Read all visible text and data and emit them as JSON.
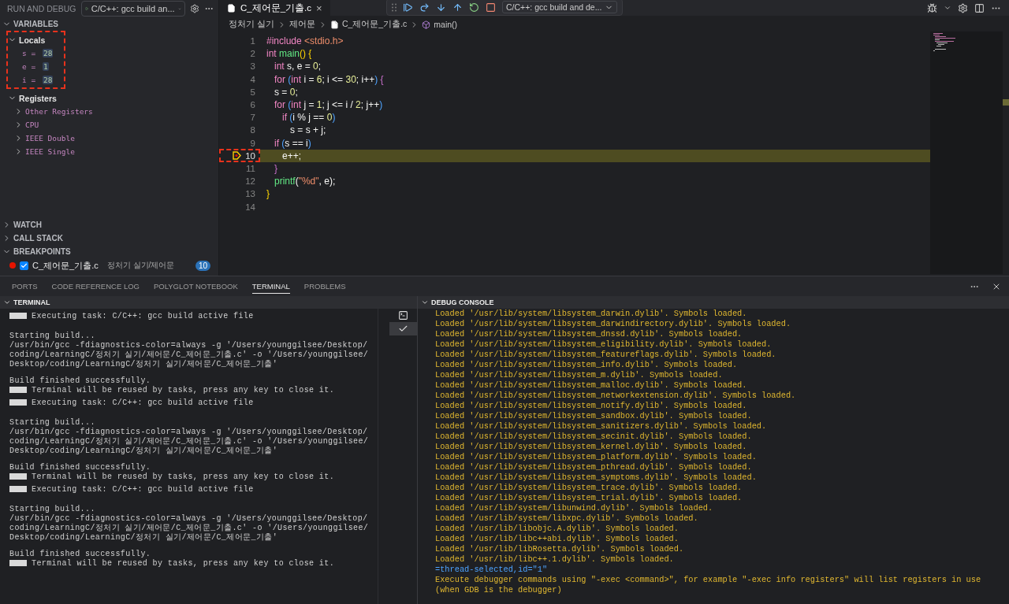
{
  "sidebar": {
    "title": "RUN AND DEBUG",
    "config": "C/C++: gcc build an...",
    "variables": {
      "title": "VARIABLES",
      "expanded": true,
      "groups": [
        {
          "label": "Locals",
          "expanded": true,
          "annotated": true,
          "children": [
            {
              "name": "s",
              "operator": "=",
              "value": "28"
            },
            {
              "name": "e",
              "operator": "=",
              "value": "1"
            },
            {
              "name": "i",
              "operator": "=",
              "value": "28"
            }
          ]
        },
        {
          "label": "Registers",
          "expanded": true,
          "annotated": false,
          "children": [
            {
              "label": "Other Registers",
              "expanded": false
            },
            {
              "label": "CPU",
              "expanded": false
            },
            {
              "label": "IEEE Double",
              "expanded": false
            },
            {
              "label": "IEEE Single",
              "expanded": false
            }
          ]
        }
      ]
    },
    "sections": [
      {
        "title": "WATCH",
        "expanded": false
      },
      {
        "title": "CALL STACK",
        "expanded": false
      },
      {
        "title": "BREAKPOINTS",
        "expanded": true
      }
    ],
    "breakpoints": [
      {
        "file": "C_제어문_기출.c",
        "path": "정처기 실기/제어문",
        "checked": true,
        "line": "10"
      }
    ]
  },
  "editor": {
    "tab": {
      "label": "C_제어문_기출.c",
      "close": "×",
      "selected": true
    },
    "debug_config": "C/C++: gcc build and de...",
    "breadcrumb": [
      "정처기 실기",
      "제어문",
      "C_제어문_기출.c",
      "main()"
    ],
    "lines": [
      {
        "number": "1",
        "current": false,
        "annotated": false,
        "tokens": [
          {
            "kind": "keyword",
            "text": "#include"
          },
          {
            "kind": "string",
            "text": " <stdio.h>"
          }
        ]
      },
      {
        "number": "2",
        "current": false,
        "annotated": false,
        "tokens": [
          {
            "kind": "keyword",
            "text": "int"
          },
          {
            "kind": "func",
            "text": " main"
          },
          {
            "kind": "bracket",
            "text": "() {"
          }
        ]
      },
      {
        "number": "3",
        "current": false,
        "annotated": false,
        "tokens": [
          {
            "kind": "keyword",
            "text": "   int"
          },
          {
            "kind": "plain",
            "text": " s, e = "
          },
          {
            "kind": "number",
            "text": "0"
          },
          {
            "kind": "plain",
            "text": ";"
          }
        ]
      },
      {
        "number": "4",
        "current": false,
        "annotated": false,
        "tokens": [
          {
            "kind": "keyword",
            "text": "   for"
          },
          {
            "kind": "paren",
            "text": " ("
          },
          {
            "kind": "keyword",
            "text": "int"
          },
          {
            "kind": "plain",
            "text": " i = "
          },
          {
            "kind": "number",
            "text": "6"
          },
          {
            "kind": "plain",
            "text": "; i <= "
          },
          {
            "kind": "number",
            "text": "30"
          },
          {
            "kind": "plain",
            "text": "; i++"
          },
          {
            "kind": "paren",
            "text": ")"
          },
          {
            "kind": "bracket2",
            "text": " {"
          }
        ]
      },
      {
        "number": "5",
        "current": false,
        "annotated": false,
        "tokens": [
          {
            "kind": "plain",
            "text": "   s = "
          },
          {
            "kind": "number",
            "text": "0"
          },
          {
            "kind": "plain",
            "text": ";"
          }
        ]
      },
      {
        "number": "6",
        "current": false,
        "annotated": false,
        "tokens": [
          {
            "kind": "keyword",
            "text": "   for"
          },
          {
            "kind": "paren",
            "text": " ("
          },
          {
            "kind": "keyword",
            "text": "int"
          },
          {
            "kind": "plain",
            "text": " j = "
          },
          {
            "kind": "number",
            "text": "1"
          },
          {
            "kind": "plain",
            "text": "; j <= i / "
          },
          {
            "kind": "number",
            "text": "2"
          },
          {
            "kind": "plain",
            "text": "; j++"
          },
          {
            "kind": "paren",
            "text": ")"
          }
        ]
      },
      {
        "number": "7",
        "current": false,
        "annotated": false,
        "tokens": [
          {
            "kind": "keyword",
            "text": "      if"
          },
          {
            "kind": "paren",
            "text": " ("
          },
          {
            "kind": "plain",
            "text": "i % j == "
          },
          {
            "kind": "number",
            "text": "0"
          },
          {
            "kind": "paren",
            "text": ")"
          }
        ]
      },
      {
        "number": "8",
        "current": false,
        "annotated": false,
        "tokens": [
          {
            "kind": "plain",
            "text": "         s = s + j;"
          }
        ]
      },
      {
        "number": "9",
        "current": false,
        "annotated": false,
        "tokens": [
          {
            "kind": "keyword",
            "text": "   if"
          },
          {
            "kind": "paren",
            "text": " ("
          },
          {
            "kind": "plain",
            "text": "s == i"
          },
          {
            "kind": "paren",
            "text": ")"
          }
        ]
      },
      {
        "number": "10",
        "current": true,
        "annotated": true,
        "tokens": [
          {
            "kind": "plain",
            "text": "      e++;"
          }
        ]
      },
      {
        "number": "11",
        "current": false,
        "annotated": false,
        "tokens": [
          {
            "kind": "bracket2",
            "text": "   }"
          }
        ]
      },
      {
        "number": "12",
        "current": false,
        "annotated": false,
        "tokens": [
          {
            "kind": "func",
            "text": "   printf"
          },
          {
            "kind": "plain",
            "text": "("
          },
          {
            "kind": "string",
            "text": "\"%d\""
          },
          {
            "kind": "plain",
            "text": ", e);"
          }
        ]
      },
      {
        "number": "13",
        "current": false,
        "annotated": false,
        "tokens": [
          {
            "kind": "bracket",
            "text": "}"
          }
        ]
      },
      {
        "number": "14",
        "current": false,
        "annotated": false
      }
    ]
  },
  "panel": {
    "tabs": [
      {
        "label": "PORTS",
        "selected": false
      },
      {
        "label": "CODE REFERENCE LOG",
        "selected": false
      },
      {
        "label": "POLYGLOT NOTEBOOK",
        "selected": false
      },
      {
        "label": "TERMINAL",
        "selected": true
      },
      {
        "label": "PROBLEMS",
        "selected": false
      }
    ],
    "terminal": {
      "title": "TERMINAL",
      "lines": [
        {
          "kind": "task",
          "text": "Executing task: C/C++: gcc build active file"
        },
        {
          "kind": "gap"
        },
        {
          "kind": "text",
          "text": "Starting build..."
        },
        {
          "kind": "text",
          "text": "/usr/bin/gcc -fdiagnostics-color=always -g '/Users/younggilsee/Desktop/coding/LearningC/정처기 실기/제어문/C_제어문_기출.c' -o '/Users/younggilsee/Desktop/coding/LearningC/정처기 실기/제어문/C_제어문_기출'"
        },
        {
          "kind": "gap"
        },
        {
          "kind": "text",
          "text": "Build finished successfully."
        },
        {
          "kind": "task",
          "text": "Terminal will be reused by tasks, press any key to close it."
        },
        {
          "kind": "task",
          "text": "Executing task: C/C++: gcc build active file"
        },
        {
          "kind": "gap"
        },
        {
          "kind": "text",
          "text": "Starting build..."
        },
        {
          "kind": "text",
          "text": "/usr/bin/gcc -fdiagnostics-color=always -g '/Users/younggilsee/Desktop/coding/LearningC/정처기 실기/제어문/C_제어문_기출.c' -o '/Users/younggilsee/Desktop/coding/LearningC/정처기 실기/제어문/C_제어문_기출'"
        },
        {
          "kind": "gap"
        },
        {
          "kind": "text",
          "text": "Build finished successfully."
        },
        {
          "kind": "task",
          "text": "Terminal will be reused by tasks, press any key to close it."
        },
        {
          "kind": "task",
          "text": "Executing task: C/C++: gcc build active file"
        },
        {
          "kind": "gap"
        },
        {
          "kind": "text",
          "text": "Starting build..."
        },
        {
          "kind": "text",
          "text": "/usr/bin/gcc -fdiagnostics-color=always -g '/Users/younggilsee/Desktop/coding/LearningC/정처기 실기/제어문/C_제어문_기출.c' -o '/Users/younggilsee/Desktop/coding/LearningC/정처기 실기/제어문/C_제어문_기출'"
        },
        {
          "kind": "gap"
        },
        {
          "kind": "text",
          "text": "Build finished successfully."
        },
        {
          "kind": "task",
          "text": "Terminal will be reused by tasks, press any key to close it."
        }
      ],
      "instances": [
        {
          "kind": "shell",
          "selected": false
        },
        {
          "kind": "task",
          "selected": true
        }
      ]
    },
    "console": {
      "title": "DEBUG CONSOLE",
      "lines": [
        {
          "kind": "loaded",
          "text": "Loaded '/usr/lib/system/libsystem_darwin.dylib'. Symbols loaded."
        },
        {
          "kind": "loaded",
          "text": "Loaded '/usr/lib/system/libsystem_darwindirectory.dylib'. Symbols loaded."
        },
        {
          "kind": "loaded",
          "text": "Loaded '/usr/lib/system/libsystem_dnssd.dylib'. Symbols loaded."
        },
        {
          "kind": "loaded",
          "text": "Loaded '/usr/lib/system/libsystem_eligibility.dylib'. Symbols loaded."
        },
        {
          "kind": "loaded",
          "text": "Loaded '/usr/lib/system/libsystem_featureflags.dylib'. Symbols loaded."
        },
        {
          "kind": "loaded",
          "text": "Loaded '/usr/lib/system/libsystem_info.dylib'. Symbols loaded."
        },
        {
          "kind": "loaded",
          "text": "Loaded '/usr/lib/system/libsystem_m.dylib'. Symbols loaded."
        },
        {
          "kind": "loaded",
          "text": "Loaded '/usr/lib/system/libsystem_malloc.dylib'. Symbols loaded."
        },
        {
          "kind": "loaded",
          "text": "Loaded '/usr/lib/system/libsystem_networkextension.dylib'. Symbols loaded."
        },
        {
          "kind": "loaded",
          "text": "Loaded '/usr/lib/system/libsystem_notify.dylib'. Symbols loaded."
        },
        {
          "kind": "loaded",
          "text": "Loaded '/usr/lib/system/libsystem_sandbox.dylib'. Symbols loaded."
        },
        {
          "kind": "loaded",
          "text": "Loaded '/usr/lib/system/libsystem_sanitizers.dylib'. Symbols loaded."
        },
        {
          "kind": "loaded",
          "text": "Loaded '/usr/lib/system/libsystem_secinit.dylib'. Symbols loaded."
        },
        {
          "kind": "loaded",
          "text": "Loaded '/usr/lib/system/libsystem_kernel.dylib'. Symbols loaded."
        },
        {
          "kind": "loaded",
          "text": "Loaded '/usr/lib/system/libsystem_platform.dylib'. Symbols loaded."
        },
        {
          "kind": "loaded",
          "text": "Loaded '/usr/lib/system/libsystem_pthread.dylib'. Symbols loaded."
        },
        {
          "kind": "loaded",
          "text": "Loaded '/usr/lib/system/libsystem_symptoms.dylib'. Symbols loaded."
        },
        {
          "kind": "loaded",
          "text": "Loaded '/usr/lib/system/libsystem_trace.dylib'. Symbols loaded."
        },
        {
          "kind": "loaded",
          "text": "Loaded '/usr/lib/system/libsystem_trial.dylib'. Symbols loaded."
        },
        {
          "kind": "loaded",
          "text": "Loaded '/usr/lib/system/libunwind.dylib'. Symbols loaded."
        },
        {
          "kind": "loaded",
          "text": "Loaded '/usr/lib/system/libxpc.dylib'. Symbols loaded."
        },
        {
          "kind": "loaded",
          "text": "Loaded '/usr/lib/libobjc.A.dylib'. Symbols loaded."
        },
        {
          "kind": "loaded",
          "text": "Loaded '/usr/lib/libc++abi.dylib'. Symbols loaded."
        },
        {
          "kind": "loaded",
          "text": "Loaded '/usr/lib/libRosetta.dylib'. Symbols loaded."
        },
        {
          "kind": "loaded",
          "text": "Loaded '/usr/lib/libc++.1.dylib'. Symbols loaded."
        },
        {
          "kind": "info",
          "text": "=thread-selected,id=\"1\""
        },
        {
          "kind": "loaded",
          "text": "Execute debugger commands using \"-exec <command>\", for example \"-exec info registers\" will list registers in use (when GDB is the debugger)"
        }
      ]
    }
  }
}
